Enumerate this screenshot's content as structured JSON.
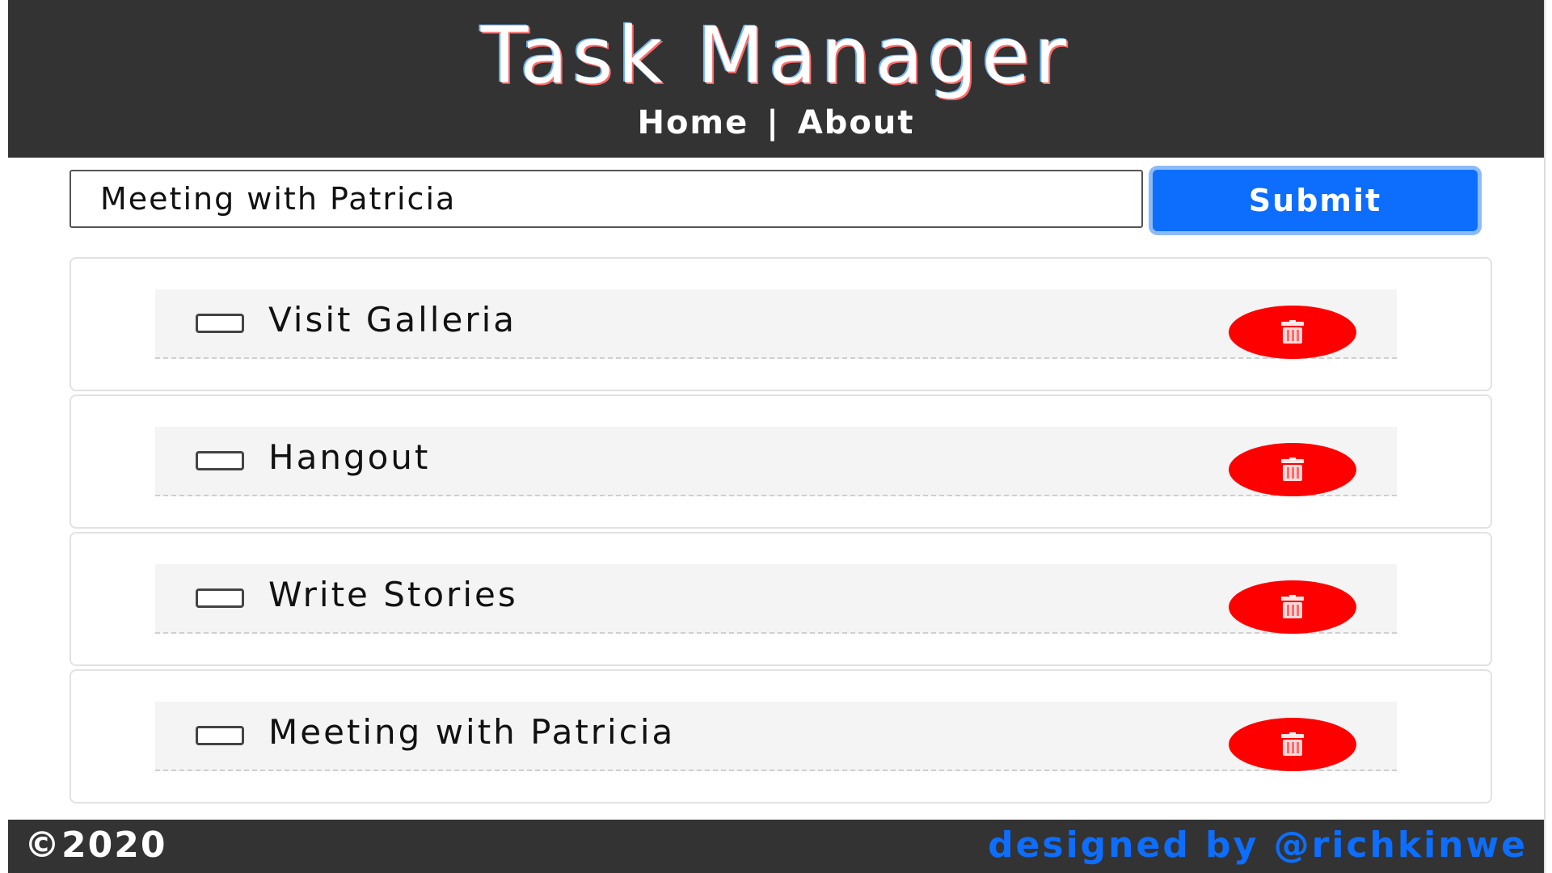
{
  "header": {
    "title": "Task Manager",
    "nav": {
      "home": "Home",
      "separator": "|",
      "about": "About"
    },
    "background_color": "#333333"
  },
  "form": {
    "input_value": "Meeting with Patricia",
    "submit_label": "Submit",
    "submit_color": "#0d6efd"
  },
  "tasks": [
    {
      "text": "Visit Galleria",
      "done": false
    },
    {
      "text": "Hangout",
      "done": false
    },
    {
      "text": "Write Stories",
      "done": false
    },
    {
      "text": "Meeting with Patricia",
      "done": false
    }
  ],
  "delete_button": {
    "icon": "trash-icon",
    "color": "#ff0000"
  },
  "footer": {
    "copyright": "©2020",
    "credit": "designed by @richkinwe",
    "credit_color": "#0d6efd"
  }
}
